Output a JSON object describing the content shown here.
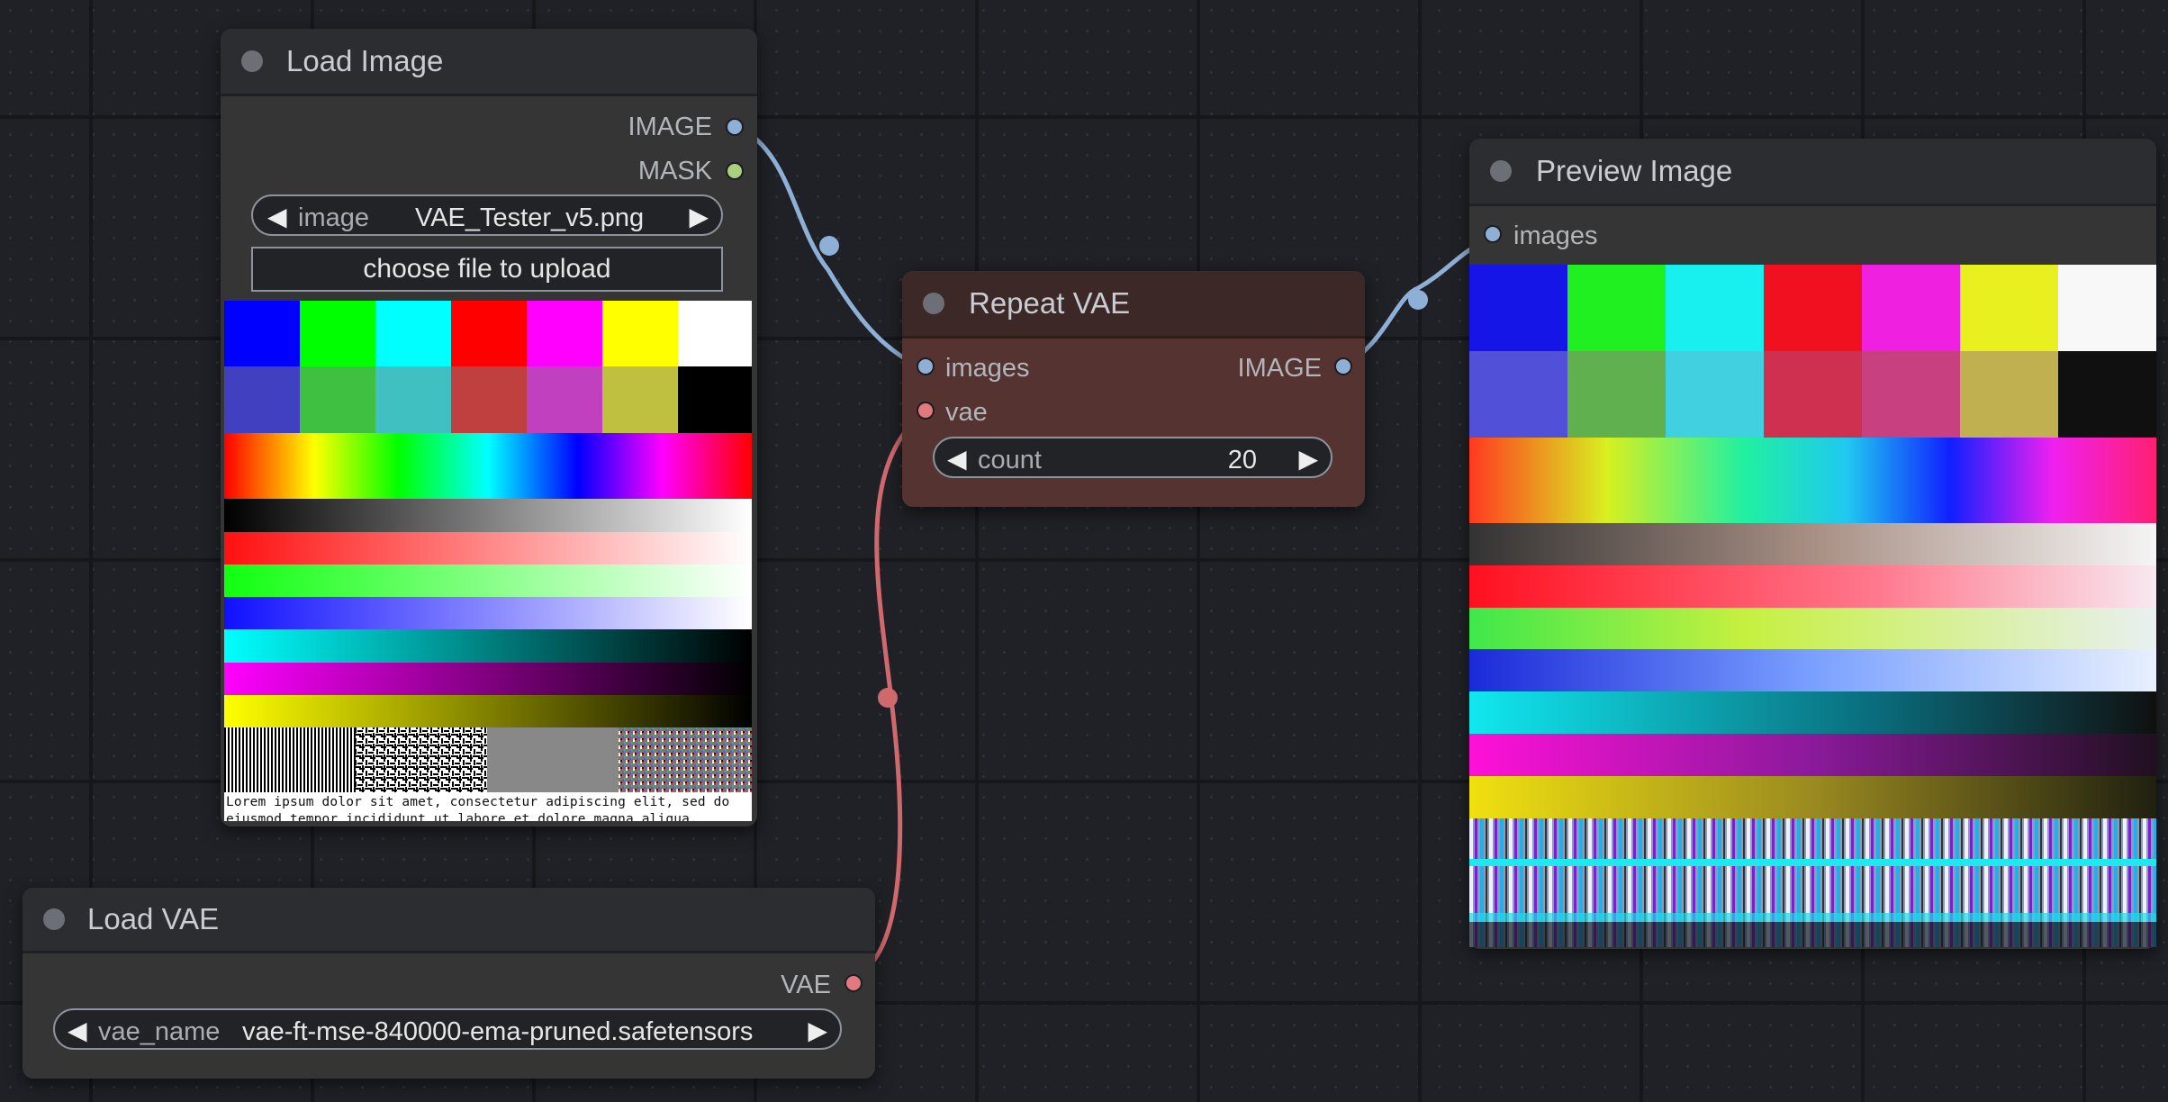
{
  "nodes": {
    "load_image": {
      "title": "Load Image",
      "outputs": [
        "IMAGE",
        "MASK"
      ],
      "image_widget": {
        "label": "image",
        "value": "VAE_Tester_v5.png"
      },
      "upload_button": "choose file to upload",
      "preview_text": [
        "Lorem ipsum dolor sit amet, consectetur adipiscing elit, sed do",
        "eiusmod tempor incididunt ut labore et dolore magna aliqua."
      ]
    },
    "load_vae": {
      "title": "Load VAE",
      "output": "VAE",
      "vae_widget": {
        "label": "vae_name",
        "value": "vae-ft-mse-840000-ema-pruned.safetensors"
      }
    },
    "repeat_vae": {
      "title": "Repeat VAE",
      "inputs": [
        "images",
        "vae"
      ],
      "output": "IMAGE",
      "count_widget": {
        "label": "count",
        "value": "20"
      }
    },
    "preview_image": {
      "title": "Preview Image",
      "input": "images"
    }
  },
  "colors": {
    "canvas": "#1f2126",
    "image_link": "#8fb0d6",
    "vae_link": "#d0696e",
    "mask_slot": "#a9d07f",
    "repeat_node_title": "#3c2927",
    "repeat_node_body": "#553331"
  }
}
